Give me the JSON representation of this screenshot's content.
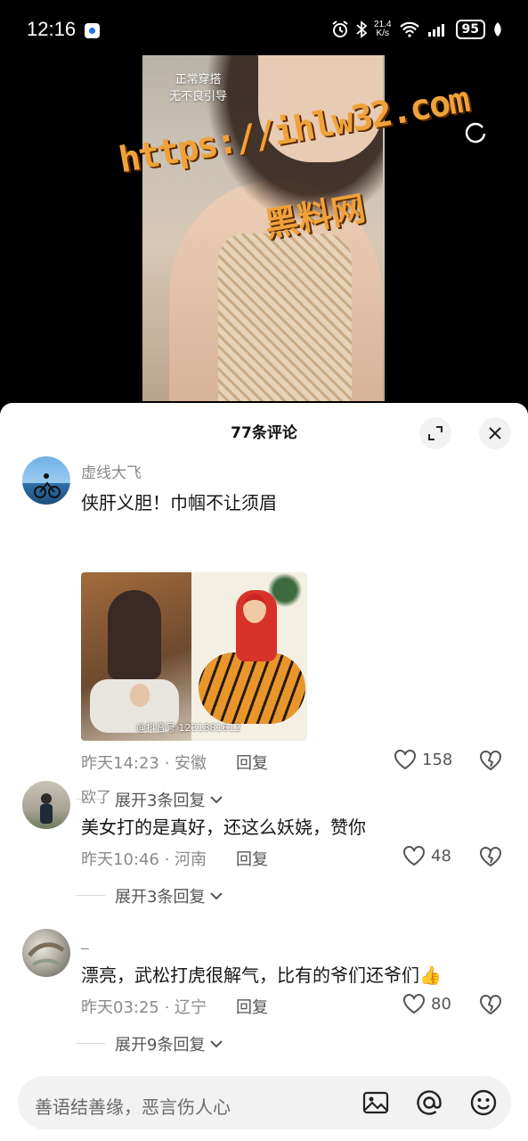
{
  "status_bar": {
    "time": "12:16",
    "net_speed_value": "21.4",
    "net_speed_unit": "K/s",
    "battery": "95"
  },
  "video": {
    "caption_line1": "正常穿搭",
    "caption_line2": "无不良引导",
    "watermark_url": "https://ihlw32.com",
    "watermark_name": "黑料网"
  },
  "comments_panel": {
    "title": "77条评论",
    "comments": [
      {
        "username": "虚线大飞",
        "text": "侠肝义胆！巾帼不让须眉",
        "image_watermark": "@抖音号 1231881612",
        "time": "昨天14:23",
        "location": "安徽",
        "reply_label": "回复",
        "likes": "158",
        "expand_label": "展开3条回复"
      },
      {
        "username": "欧了",
        "text": "美女打的是真好，还这么妖娆，赞你",
        "time": "昨天10:46",
        "location": "河南",
        "reply_label": "回复",
        "likes": "48",
        "expand_label": "展开3条回复"
      },
      {
        "username": "_",
        "text": "漂亮，武松打虎很解气，比有的爷们还爷们👍",
        "time": "昨天03:25",
        "location": "辽宁",
        "reply_label": "回复",
        "likes": "80",
        "expand_label": "展开9条回复"
      }
    ]
  },
  "input": {
    "placeholder": "善语结善缘，恶言伤人心"
  },
  "colors": {
    "watermark_orange": "#f0a23a",
    "sheet_bg": "#ffffff",
    "meta_gray": "#8a8a8a"
  }
}
